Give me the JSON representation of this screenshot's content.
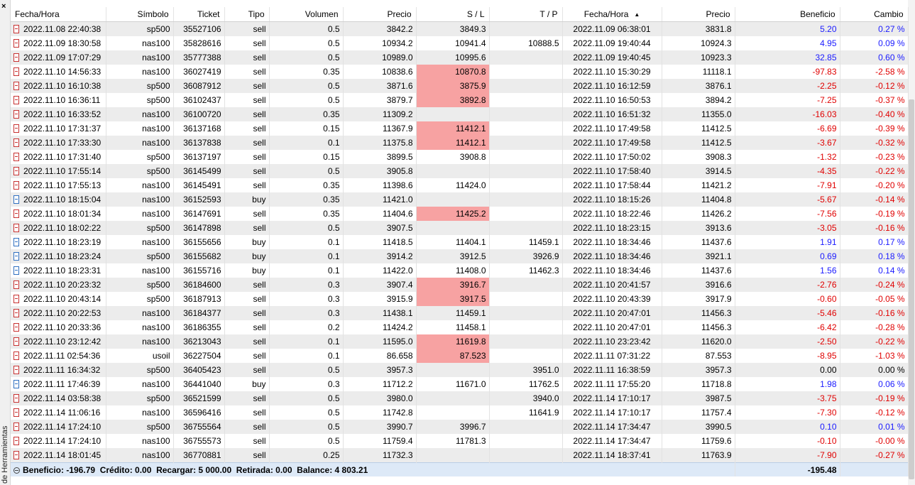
{
  "panel": {
    "vertical_label": "de Herramientas",
    "close_glyph": "×"
  },
  "columns": {
    "open_time": "Fecha/Hora",
    "symbol": "Símbolo",
    "ticket": "Ticket",
    "type": "Tipo",
    "volume": "Volumen",
    "open_price": "Precio",
    "sl": "S / L",
    "tp": "T / P",
    "close_time": "Fecha/Hora",
    "close_price": "Precio",
    "profit": "Beneficio",
    "change": "Cambio"
  },
  "sort": {
    "column": "close_time",
    "direction": "ascending",
    "glyph": "▲"
  },
  "colors": {
    "sl_highlight": "#f7a2a2",
    "positive": "#1a1aff",
    "negative": "#e00000"
  },
  "rows": [
    {
      "open_time": "2022.11.08 22:40:38",
      "symbol": "sp500",
      "ticket": "35527106",
      "type": "sell",
      "volume": "0.5",
      "open_price": "3842.2",
      "sl": "3849.3",
      "tp": "",
      "close_time": "2022.11.09 06:38:01",
      "close_price": "3831.8",
      "profit": "5.20",
      "change": "0.27 %",
      "sl_hit": false
    },
    {
      "open_time": "2022.11.09 18:30:58",
      "symbol": "nas100",
      "ticket": "35828616",
      "type": "sell",
      "volume": "0.5",
      "open_price": "10934.2",
      "sl": "10941.4",
      "tp": "10888.5",
      "close_time": "2022.11.09 19:40:44",
      "close_price": "10924.3",
      "profit": "4.95",
      "change": "0.09 %",
      "sl_hit": false
    },
    {
      "open_time": "2022.11.09 17:07:29",
      "symbol": "nas100",
      "ticket": "35777388",
      "type": "sell",
      "volume": "0.5",
      "open_price": "10989.0",
      "sl": "10995.6",
      "tp": "",
      "close_time": "2022.11.09 19:40:45",
      "close_price": "10923.3",
      "profit": "32.85",
      "change": "0.60 %",
      "sl_hit": false
    },
    {
      "open_time": "2022.11.10 14:56:33",
      "symbol": "nas100",
      "ticket": "36027419",
      "type": "sell",
      "volume": "0.35",
      "open_price": "10838.6",
      "sl": "10870.8",
      "tp": "",
      "close_time": "2022.11.10 15:30:29",
      "close_price": "11118.1",
      "profit": "-97.83",
      "change": "-2.58 %",
      "sl_hit": true
    },
    {
      "open_time": "2022.11.10 16:10:38",
      "symbol": "sp500",
      "ticket": "36087912",
      "type": "sell",
      "volume": "0.5",
      "open_price": "3871.6",
      "sl": "3875.9",
      "tp": "",
      "close_time": "2022.11.10 16:12:59",
      "close_price": "3876.1",
      "profit": "-2.25",
      "change": "-0.12 %",
      "sl_hit": true
    },
    {
      "open_time": "2022.11.10 16:36:11",
      "symbol": "sp500",
      "ticket": "36102437",
      "type": "sell",
      "volume": "0.5",
      "open_price": "3879.7",
      "sl": "3892.8",
      "tp": "",
      "close_time": "2022.11.10 16:50:53",
      "close_price": "3894.2",
      "profit": "-7.25",
      "change": "-0.37 %",
      "sl_hit": true
    },
    {
      "open_time": "2022.11.10 16:33:52",
      "symbol": "nas100",
      "ticket": "36100720",
      "type": "sell",
      "volume": "0.35",
      "open_price": "11309.2",
      "sl": "",
      "tp": "",
      "close_time": "2022.11.10 16:51:32",
      "close_price": "11355.0",
      "profit": "-16.03",
      "change": "-0.40 %",
      "sl_hit": false
    },
    {
      "open_time": "2022.11.10 17:31:37",
      "symbol": "nas100",
      "ticket": "36137168",
      "type": "sell",
      "volume": "0.15",
      "open_price": "11367.9",
      "sl": "11412.1",
      "tp": "",
      "close_time": "2022.11.10 17:49:58",
      "close_price": "11412.5",
      "profit": "-6.69",
      "change": "-0.39 %",
      "sl_hit": true
    },
    {
      "open_time": "2022.11.10 17:33:30",
      "symbol": "nas100",
      "ticket": "36137838",
      "type": "sell",
      "volume": "0.1",
      "open_price": "11375.8",
      "sl": "11412.1",
      "tp": "",
      "close_time": "2022.11.10 17:49:58",
      "close_price": "11412.5",
      "profit": "-3.67",
      "change": "-0.32 %",
      "sl_hit": true
    },
    {
      "open_time": "2022.11.10 17:31:40",
      "symbol": "sp500",
      "ticket": "36137197",
      "type": "sell",
      "volume": "0.15",
      "open_price": "3899.5",
      "sl": "3908.8",
      "tp": "",
      "close_time": "2022.11.10 17:50:02",
      "close_price": "3908.3",
      "profit": "-1.32",
      "change": "-0.23 %",
      "sl_hit": false
    },
    {
      "open_time": "2022.11.10 17:55:14",
      "symbol": "sp500",
      "ticket": "36145499",
      "type": "sell",
      "volume": "0.5",
      "open_price": "3905.8",
      "sl": "",
      "tp": "",
      "close_time": "2022.11.10 17:58:40",
      "close_price": "3914.5",
      "profit": "-4.35",
      "change": "-0.22 %",
      "sl_hit": false
    },
    {
      "open_time": "2022.11.10 17:55:13",
      "symbol": "nas100",
      "ticket": "36145491",
      "type": "sell",
      "volume": "0.35",
      "open_price": "11398.6",
      "sl": "11424.0",
      "tp": "",
      "close_time": "2022.11.10 17:58:44",
      "close_price": "11421.2",
      "profit": "-7.91",
      "change": "-0.20 %",
      "sl_hit": false
    },
    {
      "open_time": "2022.11.10 18:15:04",
      "symbol": "nas100",
      "ticket": "36152593",
      "type": "buy",
      "volume": "0.35",
      "open_price": "11421.0",
      "sl": "",
      "tp": "",
      "close_time": "2022.11.10 18:15:26",
      "close_price": "11404.8",
      "profit": "-5.67",
      "change": "-0.14 %",
      "sl_hit": false
    },
    {
      "open_time": "2022.11.10 18:01:34",
      "symbol": "nas100",
      "ticket": "36147691",
      "type": "sell",
      "volume": "0.35",
      "open_price": "11404.6",
      "sl": "11425.2",
      "tp": "",
      "close_time": "2022.11.10 18:22:46",
      "close_price": "11426.2",
      "profit": "-7.56",
      "change": "-0.19 %",
      "sl_hit": true
    },
    {
      "open_time": "2022.11.10 18:02:22",
      "symbol": "sp500",
      "ticket": "36147898",
      "type": "sell",
      "volume": "0.5",
      "open_price": "3907.5",
      "sl": "",
      "tp": "",
      "close_time": "2022.11.10 18:23:15",
      "close_price": "3913.6",
      "profit": "-3.05",
      "change": "-0.16 %",
      "sl_hit": false
    },
    {
      "open_time": "2022.11.10 18:23:19",
      "symbol": "nas100",
      "ticket": "36155656",
      "type": "buy",
      "volume": "0.1",
      "open_price": "11418.5",
      "sl": "11404.1",
      "tp": "11459.1",
      "close_time": "2022.11.10 18:34:46",
      "close_price": "11437.6",
      "profit": "1.91",
      "change": "0.17 %",
      "sl_hit": false
    },
    {
      "open_time": "2022.11.10 18:23:24",
      "symbol": "sp500",
      "ticket": "36155682",
      "type": "buy",
      "volume": "0.1",
      "open_price": "3914.2",
      "sl": "3912.5",
      "tp": "3926.9",
      "close_time": "2022.11.10 18:34:46",
      "close_price": "3921.1",
      "profit": "0.69",
      "change": "0.18 %",
      "sl_hit": false
    },
    {
      "open_time": "2022.11.10 18:23:31",
      "symbol": "nas100",
      "ticket": "36155716",
      "type": "buy",
      "volume": "0.1",
      "open_price": "11422.0",
      "sl": "11408.0",
      "tp": "11462.3",
      "close_time": "2022.11.10 18:34:46",
      "close_price": "11437.6",
      "profit": "1.56",
      "change": "0.14 %",
      "sl_hit": false
    },
    {
      "open_time": "2022.11.10 20:23:32",
      "symbol": "sp500",
      "ticket": "36184600",
      "type": "sell",
      "volume": "0.3",
      "open_price": "3907.4",
      "sl": "3916.7",
      "tp": "",
      "close_time": "2022.11.10 20:41:57",
      "close_price": "3916.6",
      "profit": "-2.76",
      "change": "-0.24 %",
      "sl_hit": true
    },
    {
      "open_time": "2022.11.10 20:43:14",
      "symbol": "sp500",
      "ticket": "36187913",
      "type": "sell",
      "volume": "0.3",
      "open_price": "3915.9",
      "sl": "3917.5",
      "tp": "",
      "close_time": "2022.11.10 20:43:39",
      "close_price": "3917.9",
      "profit": "-0.60",
      "change": "-0.05 %",
      "sl_hit": true
    },
    {
      "open_time": "2022.11.10 20:22:53",
      "symbol": "nas100",
      "ticket": "36184377",
      "type": "sell",
      "volume": "0.3",
      "open_price": "11438.1",
      "sl": "11459.1",
      "tp": "",
      "close_time": "2022.11.10 20:47:01",
      "close_price": "11456.3",
      "profit": "-5.46",
      "change": "-0.16 %",
      "sl_hit": false
    },
    {
      "open_time": "2022.11.10 20:33:36",
      "symbol": "nas100",
      "ticket": "36186355",
      "type": "sell",
      "volume": "0.2",
      "open_price": "11424.2",
      "sl": "11458.1",
      "tp": "",
      "close_time": "2022.11.10 20:47:01",
      "close_price": "11456.3",
      "profit": "-6.42",
      "change": "-0.28 %",
      "sl_hit": false
    },
    {
      "open_time": "2022.11.10 23:12:42",
      "symbol": "nas100",
      "ticket": "36213043",
      "type": "sell",
      "volume": "0.1",
      "open_price": "11595.0",
      "sl": "11619.8",
      "tp": "",
      "close_time": "2022.11.10 23:23:42",
      "close_price": "11620.0",
      "profit": "-2.50",
      "change": "-0.22 %",
      "sl_hit": true
    },
    {
      "open_time": "2022.11.11 02:54:36",
      "symbol": "usoil",
      "ticket": "36227504",
      "type": "sell",
      "volume": "0.1",
      "open_price": "86.658",
      "sl": "87.523",
      "tp": "",
      "close_time": "2022.11.11 07:31:22",
      "close_price": "87.553",
      "profit": "-8.95",
      "change": "-1.03 %",
      "sl_hit": true
    },
    {
      "open_time": "2022.11.11 16:34:32",
      "symbol": "sp500",
      "ticket": "36405423",
      "type": "sell",
      "volume": "0.5",
      "open_price": "3957.3",
      "sl": "",
      "tp": "3951.0",
      "close_time": "2022.11.11 16:38:59",
      "close_price": "3957.3",
      "profit": "0.00",
      "change": "0.00 %",
      "sl_hit": false
    },
    {
      "open_time": "2022.11.11 17:46:39",
      "symbol": "nas100",
      "ticket": "36441040",
      "type": "buy",
      "volume": "0.3",
      "open_price": "11712.2",
      "sl": "11671.0",
      "tp": "11762.5",
      "close_time": "2022.11.11 17:55:20",
      "close_price": "11718.8",
      "profit": "1.98",
      "change": "0.06 %",
      "sl_hit": false
    },
    {
      "open_time": "2022.11.14 03:58:38",
      "symbol": "sp500",
      "ticket": "36521599",
      "type": "sell",
      "volume": "0.5",
      "open_price": "3980.0",
      "sl": "",
      "tp": "3940.0",
      "close_time": "2022.11.14 17:10:17",
      "close_price": "3987.5",
      "profit": "-3.75",
      "change": "-0.19 %",
      "sl_hit": false
    },
    {
      "open_time": "2022.11.14 11:06:16",
      "symbol": "nas100",
      "ticket": "36596416",
      "type": "sell",
      "volume": "0.5",
      "open_price": "11742.8",
      "sl": "",
      "tp": "11641.9",
      "close_time": "2022.11.14 17:10:17",
      "close_price": "11757.4",
      "profit": "-7.30",
      "change": "-0.12 %",
      "sl_hit": false
    },
    {
      "open_time": "2022.11.14 17:24:10",
      "symbol": "sp500",
      "ticket": "36755564",
      "type": "sell",
      "volume": "0.5",
      "open_price": "3990.7",
      "sl": "3996.7",
      "tp": "",
      "close_time": "2022.11.14 17:34:47",
      "close_price": "3990.5",
      "profit": "0.10",
      "change": "0.01 %",
      "sl_hit": false
    },
    {
      "open_time": "2022.11.14 17:24:10",
      "symbol": "nas100",
      "ticket": "36755573",
      "type": "sell",
      "volume": "0.5",
      "open_price": "11759.4",
      "sl": "11781.3",
      "tp": "",
      "close_time": "2022.11.14 17:34:47",
      "close_price": "11759.6",
      "profit": "-0.10",
      "change": "-0.00 %",
      "sl_hit": false
    },
    {
      "open_time": "2022.11.14 18:01:45",
      "symbol": "nas100",
      "ticket": "36770881",
      "type": "sell",
      "volume": "0.25",
      "open_price": "11732.3",
      "sl": "",
      "tp": "",
      "close_time": "2022.11.14 18:37:41",
      "close_price": "11763.9",
      "profit": "-7.90",
      "change": "-0.27 %",
      "sl_hit": false
    }
  ],
  "footer": {
    "summary": "Beneficio: -196.79  Crédito: 0.00  Recargar: 5 000.00  Retirada: 0.00  Balance: 4 803.21",
    "total_profit": "-195.48"
  }
}
